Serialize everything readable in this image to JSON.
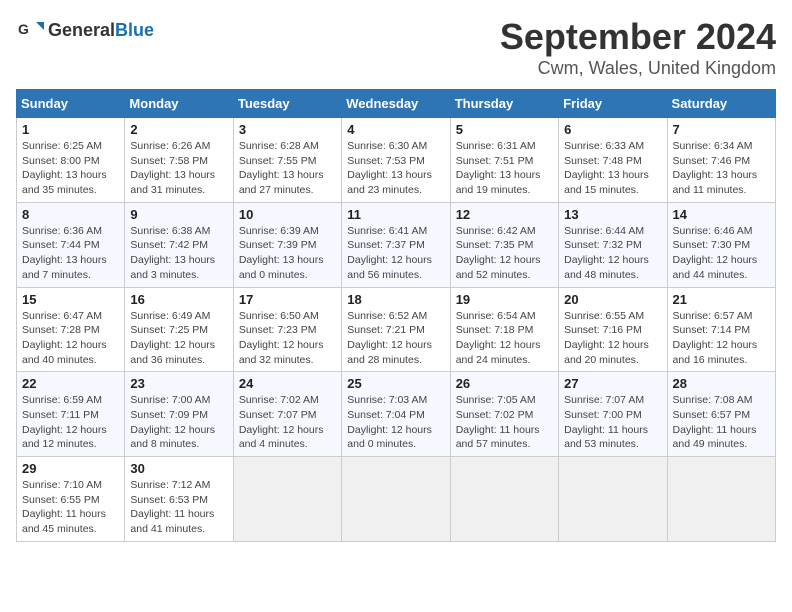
{
  "header": {
    "logo_general": "General",
    "logo_blue": "Blue",
    "title": "September 2024",
    "location": "Cwm, Wales, United Kingdom"
  },
  "weekdays": [
    "Sunday",
    "Monday",
    "Tuesday",
    "Wednesday",
    "Thursday",
    "Friday",
    "Saturday"
  ],
  "weeks": [
    [
      {
        "day": "1",
        "detail": "Sunrise: 6:25 AM\nSunset: 8:00 PM\nDaylight: 13 hours\nand 35 minutes."
      },
      {
        "day": "2",
        "detail": "Sunrise: 6:26 AM\nSunset: 7:58 PM\nDaylight: 13 hours\nand 31 minutes."
      },
      {
        "day": "3",
        "detail": "Sunrise: 6:28 AM\nSunset: 7:55 PM\nDaylight: 13 hours\nand 27 minutes."
      },
      {
        "day": "4",
        "detail": "Sunrise: 6:30 AM\nSunset: 7:53 PM\nDaylight: 13 hours\nand 23 minutes."
      },
      {
        "day": "5",
        "detail": "Sunrise: 6:31 AM\nSunset: 7:51 PM\nDaylight: 13 hours\nand 19 minutes."
      },
      {
        "day": "6",
        "detail": "Sunrise: 6:33 AM\nSunset: 7:48 PM\nDaylight: 13 hours\nand 15 minutes."
      },
      {
        "day": "7",
        "detail": "Sunrise: 6:34 AM\nSunset: 7:46 PM\nDaylight: 13 hours\nand 11 minutes."
      }
    ],
    [
      {
        "day": "8",
        "detail": "Sunrise: 6:36 AM\nSunset: 7:44 PM\nDaylight: 13 hours\nand 7 minutes."
      },
      {
        "day": "9",
        "detail": "Sunrise: 6:38 AM\nSunset: 7:42 PM\nDaylight: 13 hours\nand 3 minutes."
      },
      {
        "day": "10",
        "detail": "Sunrise: 6:39 AM\nSunset: 7:39 PM\nDaylight: 13 hours\nand 0 minutes."
      },
      {
        "day": "11",
        "detail": "Sunrise: 6:41 AM\nSunset: 7:37 PM\nDaylight: 12 hours\nand 56 minutes."
      },
      {
        "day": "12",
        "detail": "Sunrise: 6:42 AM\nSunset: 7:35 PM\nDaylight: 12 hours\nand 52 minutes."
      },
      {
        "day": "13",
        "detail": "Sunrise: 6:44 AM\nSunset: 7:32 PM\nDaylight: 12 hours\nand 48 minutes."
      },
      {
        "day": "14",
        "detail": "Sunrise: 6:46 AM\nSunset: 7:30 PM\nDaylight: 12 hours\nand 44 minutes."
      }
    ],
    [
      {
        "day": "15",
        "detail": "Sunrise: 6:47 AM\nSunset: 7:28 PM\nDaylight: 12 hours\nand 40 minutes."
      },
      {
        "day": "16",
        "detail": "Sunrise: 6:49 AM\nSunset: 7:25 PM\nDaylight: 12 hours\nand 36 minutes."
      },
      {
        "day": "17",
        "detail": "Sunrise: 6:50 AM\nSunset: 7:23 PM\nDaylight: 12 hours\nand 32 minutes."
      },
      {
        "day": "18",
        "detail": "Sunrise: 6:52 AM\nSunset: 7:21 PM\nDaylight: 12 hours\nand 28 minutes."
      },
      {
        "day": "19",
        "detail": "Sunrise: 6:54 AM\nSunset: 7:18 PM\nDaylight: 12 hours\nand 24 minutes."
      },
      {
        "day": "20",
        "detail": "Sunrise: 6:55 AM\nSunset: 7:16 PM\nDaylight: 12 hours\nand 20 minutes."
      },
      {
        "day": "21",
        "detail": "Sunrise: 6:57 AM\nSunset: 7:14 PM\nDaylight: 12 hours\nand 16 minutes."
      }
    ],
    [
      {
        "day": "22",
        "detail": "Sunrise: 6:59 AM\nSunset: 7:11 PM\nDaylight: 12 hours\nand 12 minutes."
      },
      {
        "day": "23",
        "detail": "Sunrise: 7:00 AM\nSunset: 7:09 PM\nDaylight: 12 hours\nand 8 minutes."
      },
      {
        "day": "24",
        "detail": "Sunrise: 7:02 AM\nSunset: 7:07 PM\nDaylight: 12 hours\nand 4 minutes."
      },
      {
        "day": "25",
        "detail": "Sunrise: 7:03 AM\nSunset: 7:04 PM\nDaylight: 12 hours\nand 0 minutes."
      },
      {
        "day": "26",
        "detail": "Sunrise: 7:05 AM\nSunset: 7:02 PM\nDaylight: 11 hours\nand 57 minutes."
      },
      {
        "day": "27",
        "detail": "Sunrise: 7:07 AM\nSunset: 7:00 PM\nDaylight: 11 hours\nand 53 minutes."
      },
      {
        "day": "28",
        "detail": "Sunrise: 7:08 AM\nSunset: 6:57 PM\nDaylight: 11 hours\nand 49 minutes."
      }
    ],
    [
      {
        "day": "29",
        "detail": "Sunrise: 7:10 AM\nSunset: 6:55 PM\nDaylight: 11 hours\nand 45 minutes."
      },
      {
        "day": "30",
        "detail": "Sunrise: 7:12 AM\nSunset: 6:53 PM\nDaylight: 11 hours\nand 41 minutes."
      },
      {
        "day": "",
        "detail": ""
      },
      {
        "day": "",
        "detail": ""
      },
      {
        "day": "",
        "detail": ""
      },
      {
        "day": "",
        "detail": ""
      },
      {
        "day": "",
        "detail": ""
      }
    ]
  ]
}
